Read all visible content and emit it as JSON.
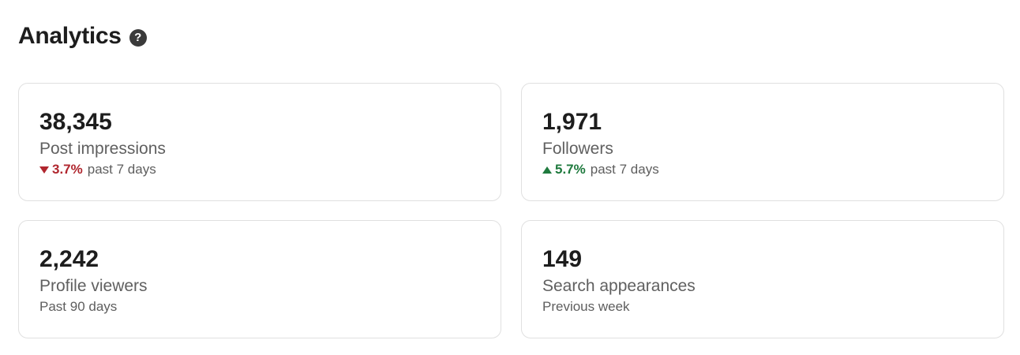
{
  "header": {
    "title": "Analytics",
    "help_glyph": "?"
  },
  "cards": [
    {
      "value": "38,345",
      "label": "Post impressions",
      "trend": "down",
      "change": "3.7%",
      "period": "past 7 days",
      "trend_color": "#b0262e"
    },
    {
      "value": "1,971",
      "label": "Followers",
      "trend": "up",
      "change": "5.7%",
      "period": "past 7 days",
      "trend_color": "#1f7a3e"
    },
    {
      "value": "2,242",
      "label": "Profile viewers",
      "period": "Past 90 days"
    },
    {
      "value": "149",
      "label": "Search appearances",
      "period": "Previous week"
    }
  ],
  "icons": {
    "help": "help-icon",
    "trend_down": "triangle-down-icon",
    "trend_up": "triangle-up-icon"
  }
}
